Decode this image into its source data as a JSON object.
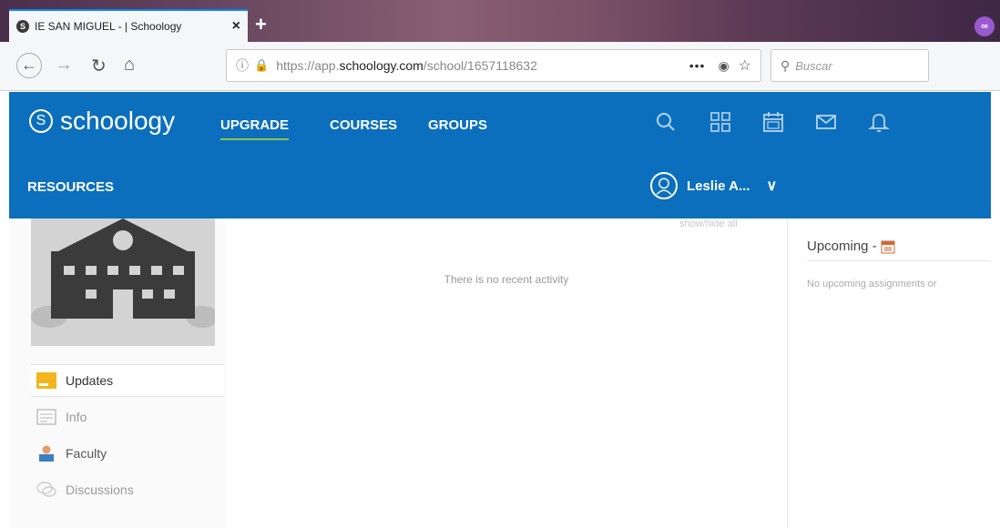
{
  "browser": {
    "tab_title": "IE SAN MIGUEL - | Schoology",
    "tab_close": "×",
    "new_tab": "+",
    "url_prefix": "https://app.",
    "url_domain": "schoology.com",
    "url_path": "/school/1657118632",
    "url_more": "•••",
    "search_placeholder": "Buscar"
  },
  "header": {
    "logo_text": "schoology",
    "nav": {
      "upgrade": "UPGRADE",
      "courses": "COURSES",
      "groups": "GROUPS",
      "resources": "RESOURCES"
    },
    "user_name": "Leslie A...",
    "icons": [
      "search-icon",
      "apps-grid-icon",
      "calendar-icon",
      "messages-icon",
      "notifications-icon"
    ],
    "accent": "#0c6fbd"
  },
  "sidebar": {
    "items": [
      {
        "label": "Updates",
        "icon": "updates-icon"
      },
      {
        "label": "Info",
        "icon": "info-icon"
      },
      {
        "label": "Faculty",
        "icon": "faculty-icon"
      },
      {
        "label": "Discussions",
        "icon": "discussions-icon"
      }
    ]
  },
  "main": {
    "faint_link": "show/hide all",
    "empty_message": "There is no recent activity"
  },
  "right": {
    "upcoming_title": "Upcoming -",
    "upcoming_empty": "No upcoming assignments or"
  }
}
